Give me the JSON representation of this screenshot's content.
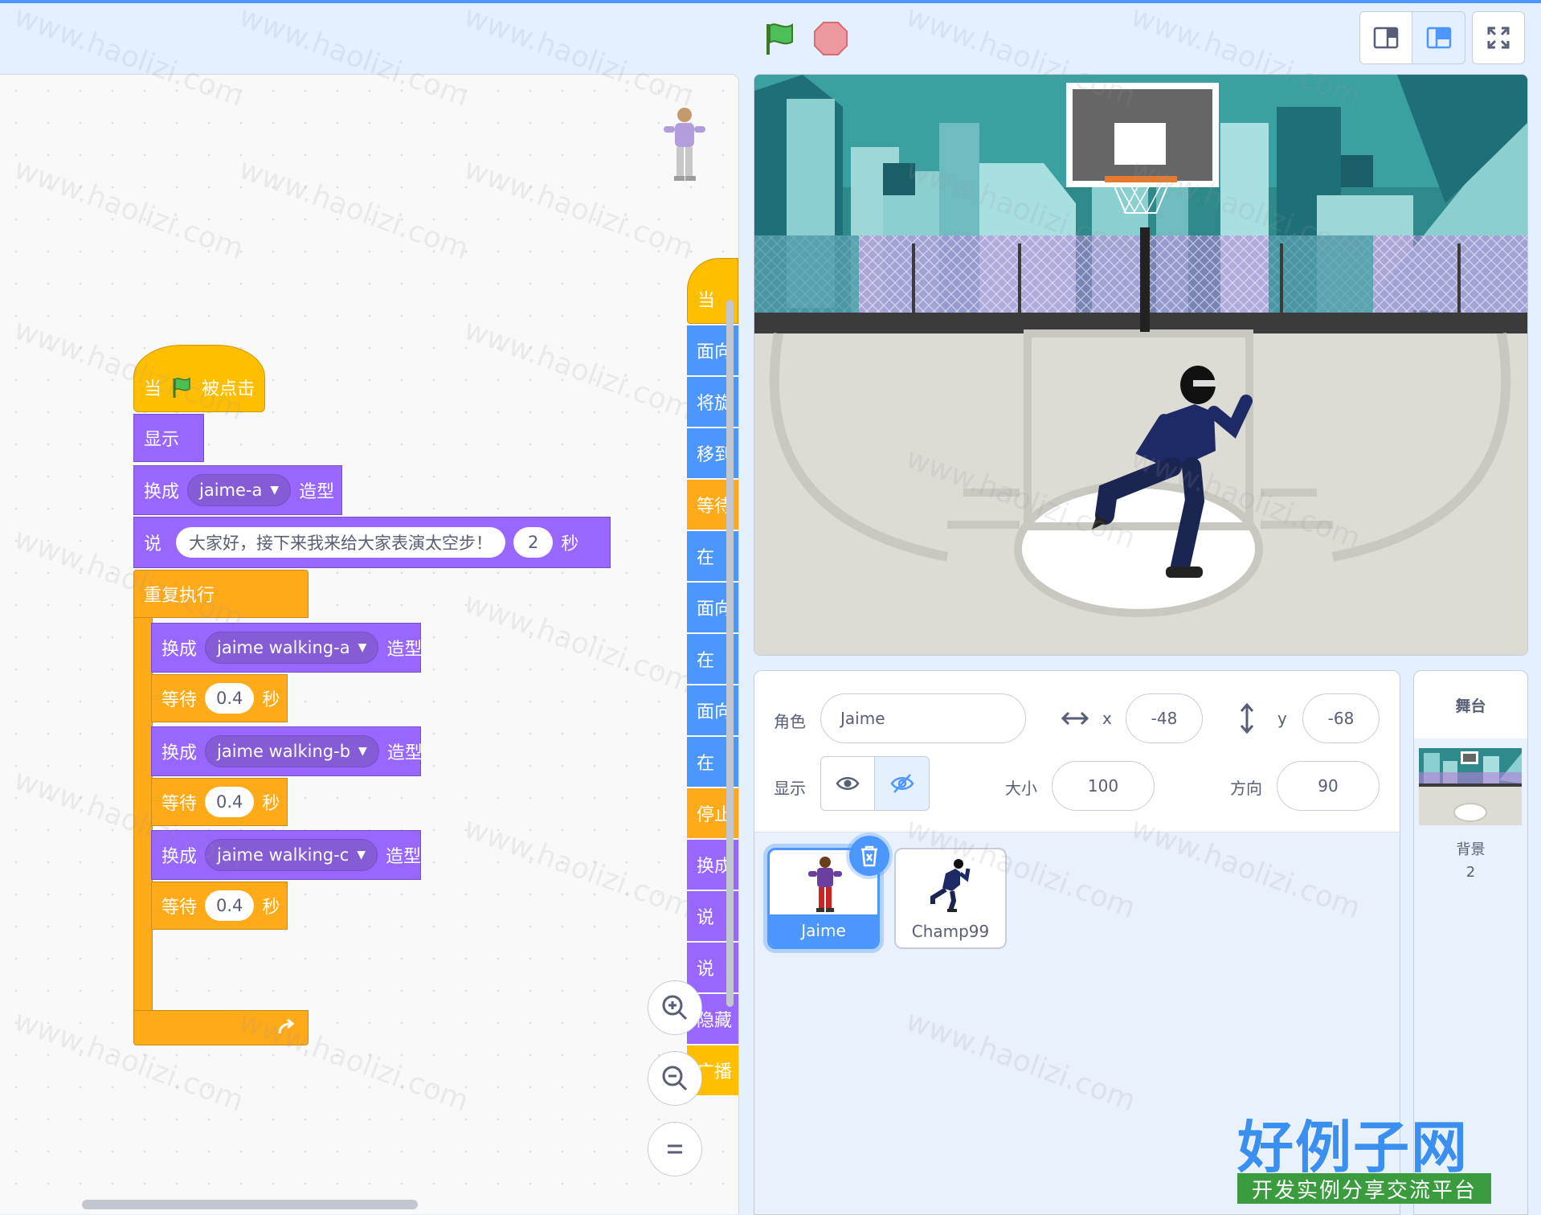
{
  "toolbar": {
    "green_flag_icon": "green-flag-icon",
    "stop_icon": "stop-sign-icon"
  },
  "script": {
    "hat": {
      "when": "当",
      "clicked": "被点击"
    },
    "show": "显示",
    "switch1": {
      "prefix": "换成",
      "costume": "jaime-a",
      "suffix": "造型"
    },
    "say": {
      "prefix": "说",
      "message": "大家好，接下来我来给大家表演太空步！",
      "secs": "2",
      "unit": "秒"
    },
    "forever": "重复执行",
    "loop": [
      {
        "kind": "switch",
        "prefix": "换成",
        "costume": "jaime walking-a",
        "suffix": "造型"
      },
      {
        "kind": "wait",
        "prefix": "等待",
        "value": "0.4",
        "unit": "秒"
      },
      {
        "kind": "switch",
        "prefix": "换成",
        "costume": "jaime walking-b",
        "suffix": "造型"
      },
      {
        "kind": "wait",
        "prefix": "等待",
        "value": "0.4",
        "unit": "秒"
      },
      {
        "kind": "switch",
        "prefix": "换成",
        "costume": "jaime walking-c",
        "suffix": "造型"
      },
      {
        "kind": "wait",
        "prefix": "等待",
        "value": "0.4",
        "unit": "秒"
      }
    ]
  },
  "script2": [
    {
      "text": "当",
      "cat": "event"
    },
    {
      "text": "面向",
      "cat": "motion"
    },
    {
      "text": "将旋",
      "cat": "motion"
    },
    {
      "text": "移到",
      "cat": "motion"
    },
    {
      "text": "等待",
      "cat": "control"
    },
    {
      "text": "在",
      "cat": "motion"
    },
    {
      "text": "面向",
      "cat": "motion"
    },
    {
      "text": "在",
      "cat": "motion"
    },
    {
      "text": "面向",
      "cat": "motion"
    },
    {
      "text": "在",
      "cat": "motion"
    },
    {
      "text": "停止",
      "cat": "control"
    },
    {
      "text": "换成",
      "cat": "looks"
    },
    {
      "text": "说",
      "cat": "looks"
    },
    {
      "text": "说",
      "cat": "looks"
    },
    {
      "text": "隐藏",
      "cat": "looks"
    },
    {
      "text": "广播",
      "cat": "event"
    }
  ],
  "sprite_info": {
    "sprite_label": "角色",
    "sprite_name": "Jaime",
    "x_label": "x",
    "x_value": "-48",
    "y_label": "y",
    "y_value": "-68",
    "show_label": "显示",
    "size_label": "大小",
    "size_value": "100",
    "direction_label": "方向",
    "direction_value": "90"
  },
  "sprites": [
    {
      "name": "Jaime",
      "selected": true
    },
    {
      "name": "Champ99",
      "selected": false
    }
  ],
  "stage_panel": {
    "title": "舞台",
    "backdrops_label": "背景",
    "backdrops_count": "2"
  },
  "watermark": {
    "text": "www.haolizi.com",
    "brand": "好例子网",
    "tagline": "开发实例分享交流平台"
  },
  "colors": {
    "accent": "#4c97ff",
    "looks": "#9966ff",
    "events": "#ffbf00",
    "control": "#ffab19",
    "motion": "#4c97ff"
  }
}
